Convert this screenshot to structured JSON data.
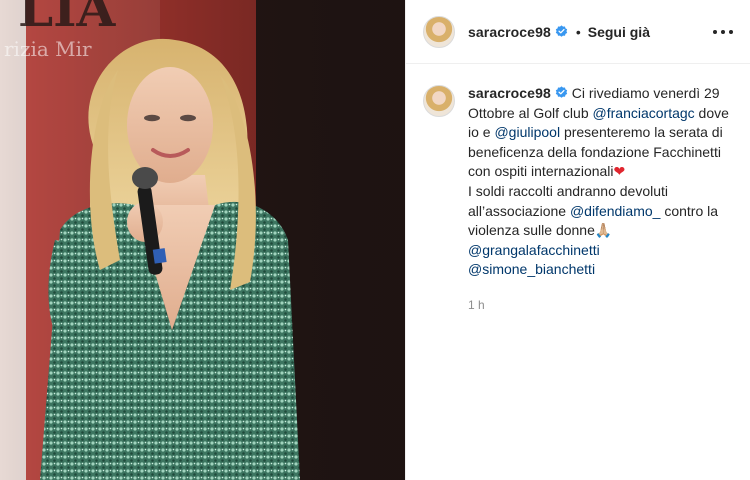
{
  "post": {
    "author": "saracroce98",
    "verified": true,
    "separator": "•",
    "follow_label": "Segui già",
    "more_icon": "more-horizontal-icon",
    "photo_text": "LIA",
    "photo_subtext": "rizia Mir"
  },
  "caption": {
    "author": "saracroce98",
    "t1": " Ci rivediamo venerdì 29 Ottobre al Golf club ",
    "m1": "@franciacortagc",
    "t2": " dove io e ",
    "m2": "@giulipool",
    "t3": " presenteremo la serata di beneficenza della fondazione Facchinetti con ospiti internazionali",
    "heart": "❤",
    "t4": "I soldi raccolti andranno devoluti all’associazione ",
    "m3": "@difendiamo_",
    "t5": " contro la violenza sulle donne",
    "hands": "🙏🏼",
    "m4": "@grangalafacchinetti",
    "m5": "@simone_bianchetti",
    "time": "1 h"
  },
  "colors": {
    "verified_blue": "#3897f0",
    "mention_blue": "#00376b",
    "heart_red": "#e0262f",
    "dress_green": "#3f7a62"
  }
}
